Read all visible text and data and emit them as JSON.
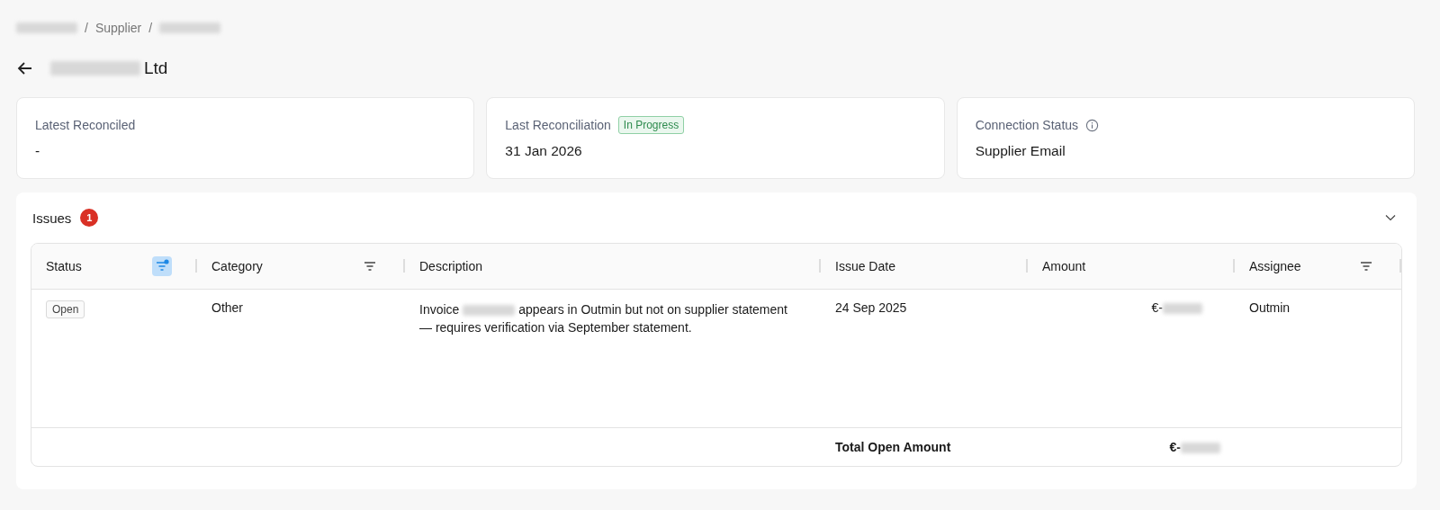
{
  "breadcrumb": {
    "separator": "/",
    "items": [
      {
        "kind": "redacted"
      },
      {
        "kind": "text",
        "label": "Supplier"
      },
      {
        "kind": "redacted"
      }
    ]
  },
  "title": {
    "parts": [
      {
        "kind": "redacted"
      },
      {
        "kind": "text",
        "text": "Ltd"
      }
    ]
  },
  "cards": [
    {
      "label": "Latest Reconciled",
      "value": "-"
    },
    {
      "label": "Last Reconciliation",
      "badge": "In Progress",
      "value": "31 Jan 2026"
    },
    {
      "label": "Connection Status",
      "info": true,
      "value": "Supplier Email"
    }
  ],
  "issues": {
    "title": "Issues",
    "count": "1",
    "expanded": true,
    "table": {
      "columns": [
        {
          "label": "Status",
          "filter": true,
          "filter_active": true
        },
        {
          "label": "Category",
          "filter": true,
          "filter_active": false
        },
        {
          "label": "Description",
          "filter": false
        },
        {
          "label": "Issue Date",
          "filter": false
        },
        {
          "label": "Amount",
          "filter": false
        },
        {
          "label": "Assignee",
          "filter": true,
          "filter_active": false
        }
      ],
      "rows": [
        {
          "status": "Open",
          "category": "Other",
          "description": [
            {
              "kind": "text",
              "text": "Invoice"
            },
            {
              "kind": "redacted"
            },
            {
              "kind": "text",
              "text": "appears in Outmin but not on supplier statement — requires verification via September statement."
            }
          ],
          "issue_date": "24 Sep 2025",
          "amount_prefix": "€-",
          "assignee": "Outmin"
        }
      ],
      "footer": {
        "label": "Total Open Amount",
        "amount_prefix": "€-"
      }
    }
  }
}
